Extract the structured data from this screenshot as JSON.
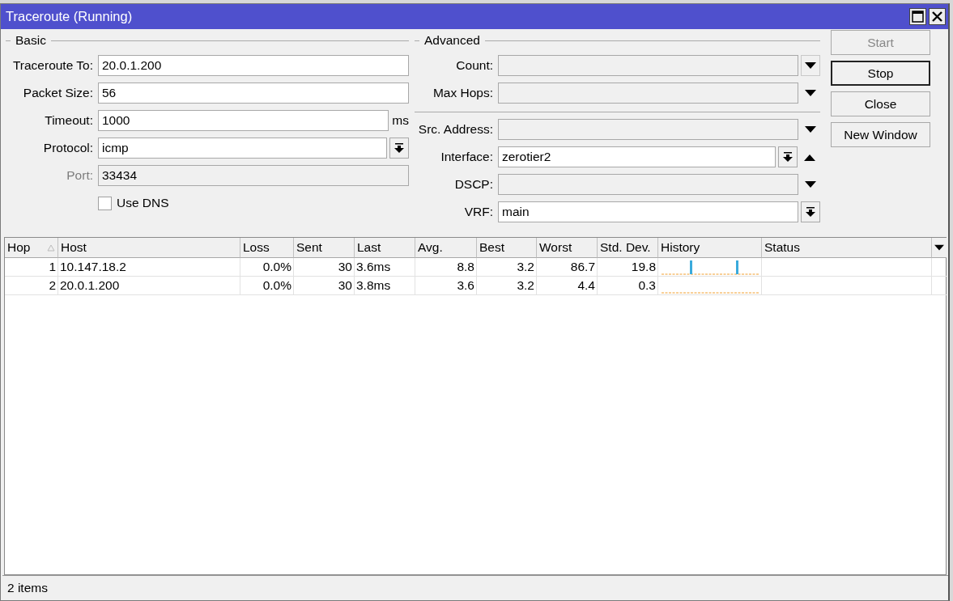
{
  "window": {
    "title": "Traceroute (Running)"
  },
  "basic": {
    "title": "Basic",
    "fields": [
      {
        "label": "Traceroute To:",
        "value": "20.0.1.200",
        "disabled": false,
        "dropdown": false
      },
      {
        "label": "Packet Size:",
        "value": "56",
        "disabled": false,
        "dropdown": false
      },
      {
        "label": "Timeout:",
        "value": "1000",
        "unit": "ms",
        "disabled": false,
        "dropdown": false
      },
      {
        "label": "Protocol:",
        "value": "icmp",
        "disabled": false,
        "dropdown": true
      },
      {
        "label": "Port:",
        "value": "33434",
        "disabled": true,
        "dropdown": false
      }
    ],
    "use_dns": {
      "label": "Use DNS",
      "checked": false
    }
  },
  "advanced": {
    "title": "Advanced",
    "groups": [
      [
        {
          "label": "Count:",
          "set": false,
          "dropdown": false,
          "expanded": false,
          "arrow_highlighted": true
        },
        {
          "label": "Max Hops:",
          "set": false,
          "dropdown": false,
          "expanded": false,
          "arrow_highlighted": false
        }
      ],
      [
        {
          "label": "Src. Address:",
          "set": false,
          "dropdown": false,
          "expanded": false,
          "arrow_highlighted": false
        },
        {
          "label": "Interface:",
          "value": "zerotier2",
          "set": true,
          "dropdown": true,
          "expanded": true,
          "arrow_highlighted": false
        },
        {
          "label": "DSCP:",
          "set": false,
          "dropdown": false,
          "expanded": false,
          "arrow_highlighted": false
        },
        {
          "label": "VRF:",
          "value": "main",
          "set": true,
          "dropdown": true
        }
      ]
    ]
  },
  "buttons": [
    {
      "label": "Start",
      "disabled": true,
      "default": false
    },
    {
      "label": "Stop",
      "disabled": false,
      "default": true
    },
    {
      "label": "Close",
      "disabled": false,
      "default": false
    },
    {
      "label": "New Window",
      "disabled": false,
      "default": false
    }
  ],
  "table": {
    "columns": [
      {
        "label": "Hop",
        "sorted": true
      },
      {
        "label": "Host",
        "sorted": false
      },
      {
        "label": "Loss",
        "sorted": false
      },
      {
        "label": "Sent",
        "sorted": false
      },
      {
        "label": "Last",
        "sorted": false
      },
      {
        "label": "Avg.",
        "sorted": false
      },
      {
        "label": "Best",
        "sorted": false
      },
      {
        "label": "Worst",
        "sorted": false
      },
      {
        "label": "Std. Dev.",
        "sorted": false
      },
      {
        "label": "History",
        "sorted": false
      },
      {
        "label": "Status",
        "sorted": false
      }
    ],
    "rows": [
      {
        "cells": [
          "1",
          "10.147.18.2",
          "0.0%",
          "30",
          "3.6ms",
          "8.8",
          "3.2",
          "86.7",
          "19.8"
        ],
        "history_spikes": true
      },
      {
        "cells": [
          "2",
          "20.0.1.200",
          "0.0%",
          "30",
          "3.8ms",
          "3.6",
          "3.2",
          "4.4",
          "0.3"
        ],
        "history_spikes": false
      }
    ]
  },
  "status_bar": {
    "text": "2 items"
  }
}
